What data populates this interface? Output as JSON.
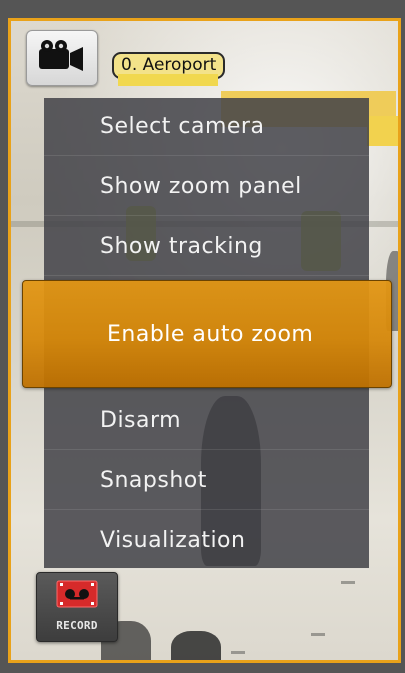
{
  "camera": {
    "title": "0. Aeroport",
    "icon": "video-camera-icon"
  },
  "menu": {
    "items": [
      {
        "label": "Select camera"
      },
      {
        "label": "Show zoom panel"
      },
      {
        "label": "Show tracking"
      },
      {
        "label": "Enable auto zoom",
        "state": "highlighted"
      },
      {
        "label": "Disarm"
      },
      {
        "label": "Snapshot"
      },
      {
        "label": "Visualization"
      }
    ]
  },
  "record": {
    "label": "RECORD",
    "icon": "record-tape-icon"
  },
  "colors": {
    "accent": "#e09a14",
    "frame_border": "#e9a21a",
    "menu_bg": "#424248",
    "record_icon": "#d62a2a"
  }
}
